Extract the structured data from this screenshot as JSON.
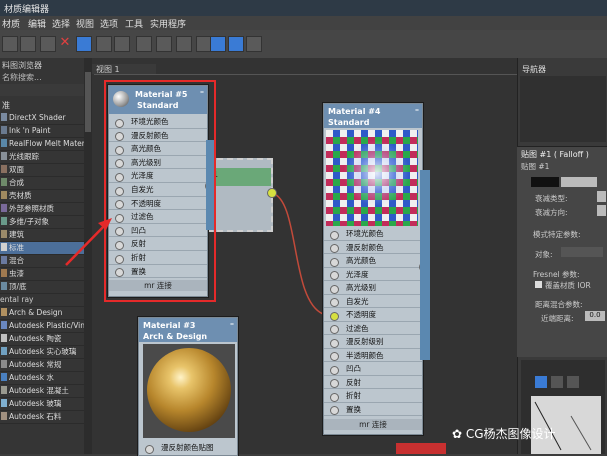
{
  "window": {
    "title": "材质编辑器"
  },
  "menu": [
    "材质",
    "编辑",
    "选择",
    "视图",
    "选项",
    "工具",
    "实用程序"
  ],
  "left_panel": {
    "title": "料图浏览器",
    "search_placeholder": "名称搜索...",
    "section": "准",
    "items": [
      {
        "label": "DirectX Shader",
        "color": "#7a8aa0"
      },
      {
        "label": "Ink 'n Paint",
        "color": "#6a7a8f"
      },
      {
        "label": "RealFlow Melt Mater...",
        "color": "#5a88a8"
      },
      {
        "label": "光线跟踪",
        "color": "#889098"
      },
      {
        "label": "双面",
        "color": "#8a7060"
      },
      {
        "label": "合成",
        "color": "#6e8a6a"
      },
      {
        "label": "壳材质",
        "color": "#a08a60"
      },
      {
        "label": "外部参照材质",
        "color": "#7a6a9a"
      },
      {
        "label": "多维/子对象",
        "color": "#6a9a8a"
      },
      {
        "label": "建筑",
        "color": "#9a8a6a"
      },
      {
        "label": "标准",
        "color": "#d0d0d0",
        "selected": true
      },
      {
        "label": "混合",
        "color": "#6a7aa0"
      },
      {
        "label": "虫漆",
        "color": "#a07a50"
      },
      {
        "label": "顶/底",
        "color": "#6a8aa0"
      }
    ],
    "section2": "ental ray",
    "items2": [
      {
        "label": "Arch & Design",
        "color": "#b09060"
      },
      {
        "label": "Autodesk Plastic/Vinyl",
        "color": "#6a88c0"
      },
      {
        "label": "Autodesk 陶瓷",
        "color": "#c0c0c0"
      },
      {
        "label": "Autodesk 实心玻璃",
        "color": "#70a0c0"
      },
      {
        "label": "Autodesk 常规",
        "color": "#8a8a8a"
      },
      {
        "label": "Autodesk 水",
        "color": "#4a80c0"
      },
      {
        "label": "Autodesk 混凝土",
        "color": "#9a9a90"
      },
      {
        "label": "Autodesk 玻璃",
        "color": "#80b0d0"
      },
      {
        "label": "Autodesk 石料",
        "color": "#a09080"
      }
    ]
  },
  "canvas": {
    "tab": "视图 1"
  },
  "node5": {
    "title": "Material #5",
    "subtitle": "Standard",
    "rows": [
      "环境光颜色",
      "漫反射颜色",
      "高光颜色",
      "高光级别",
      "光泽度",
      "自发光",
      "不透明度",
      "过滤色",
      "凹凸",
      "反射",
      "折射",
      "置换"
    ],
    "footer": "mr 连接"
  },
  "node4": {
    "title": "Material #4",
    "subtitle": "Standard",
    "rows": [
      "环境光颜色",
      "漫反射颜色",
      "高光颜色",
      "光泽度",
      "高光级别",
      "自发光",
      "不透明度",
      "过滤色",
      "漫反射级别",
      "半透明颜色",
      "凹凸",
      "反射",
      "折射",
      "置换"
    ],
    "footer": "mr 连接"
  },
  "node3": {
    "title": "Material #3",
    "subtitle": "Arch & Design",
    "rows": [
      "漫反射颜色贴图"
    ]
  },
  "node_hidden": {
    "label": "1"
  },
  "right_panel": {
    "navigator": "导航器",
    "map_title": "贴图 #1 ( Falloff )",
    "map_sub": "贴图 #1",
    "fields": [
      "衰减类型:",
      "衰减方向:"
    ],
    "section": "模式特定参数:",
    "object_label": "对象:",
    "fresnel": "Fresnel 参数:",
    "ior_override": "覆盖材质 IOR",
    "distance": "距离混合参数:",
    "near": "近端距离:",
    "near_value": "0.0"
  },
  "watermark": "CG杨杰图像设计"
}
